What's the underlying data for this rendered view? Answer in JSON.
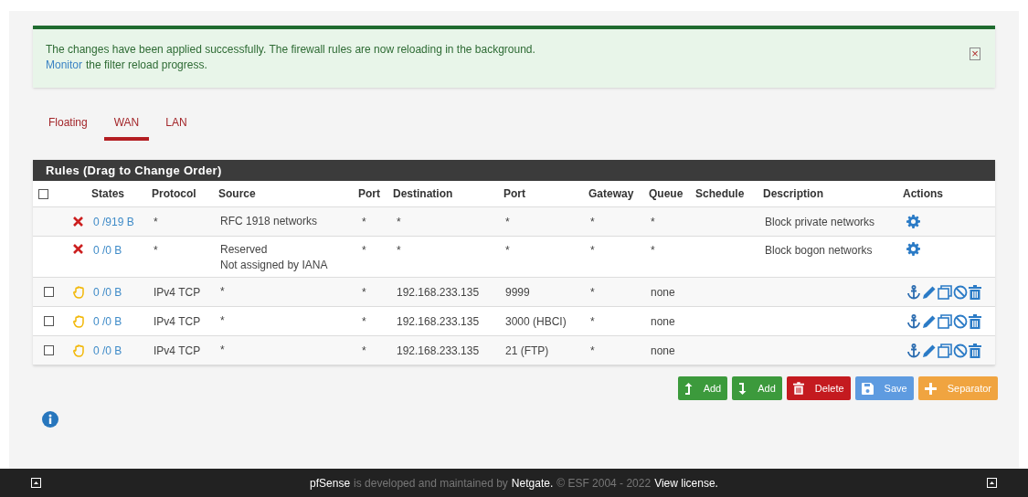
{
  "alert": {
    "message": "The changes have been applied successfully. The firewall rules are now reloading in the background.",
    "link": "Monitor",
    "link_rest": "the filter reload progress.",
    "close": "×"
  },
  "tabs": [
    {
      "label": "Floating",
      "selected": false
    },
    {
      "label": "WAN",
      "selected": true
    },
    {
      "label": "LAN",
      "selected": false
    }
  ],
  "panel": {
    "title": "Rules (Drag to Change Order)"
  },
  "table": {
    "select_all_checked": false,
    "columns": [
      "States",
      "Protocol",
      "Source",
      "Port",
      "Destination",
      "Port",
      "Gateway",
      "Queue",
      "Schedule",
      "Description",
      "Actions"
    ],
    "rows": [
      {
        "kind": "block",
        "states": "0 /919 B",
        "protocol": "*",
        "source": [
          "RFC 1918 networks"
        ],
        "source_port": "*",
        "destination": "*",
        "port": "*",
        "gateway": "*",
        "queue": "*",
        "description": "Block private networks"
      },
      {
        "kind": "block",
        "states": "0 /0 B",
        "protocol": "*",
        "source": [
          "Reserved",
          "Not assigned by IANA"
        ],
        "source_port": "*",
        "destination": "*",
        "port": "*",
        "gateway": "*",
        "queue": "*",
        "description": "Block bogon networks"
      },
      {
        "kind": "pass",
        "checked": false,
        "states": "0 /0 B",
        "protocol": "IPv4 TCP",
        "source": [
          "*"
        ],
        "source_port": "*",
        "destination": "192.168.233.135",
        "port": "9999",
        "gateway": "*",
        "queue": "none"
      },
      {
        "kind": "pass",
        "checked": false,
        "states": "0 /0 B",
        "protocol": "IPv4 TCP",
        "source": [
          "*"
        ],
        "source_port": "*",
        "destination": "192.168.233.135",
        "port": "3000 (HBCI)",
        "gateway": "*",
        "queue": "none"
      },
      {
        "kind": "pass",
        "checked": false,
        "states": "0 /0 B",
        "protocol": "IPv4 TCP",
        "source": [
          "*"
        ],
        "source_port": "*",
        "destination": "192.168.233.135",
        "port": "21 (FTP)",
        "gateway": "*",
        "queue": "none"
      }
    ]
  },
  "buttons": [
    {
      "kind": "add_top",
      "label": "Add"
    },
    {
      "kind": "add_bottom",
      "label": "Add"
    },
    {
      "kind": "delete",
      "label": "Delete"
    },
    {
      "kind": "save",
      "label": "Save"
    },
    {
      "kind": "separator",
      "label": "Separator"
    }
  ],
  "footer": {
    "brand": "pfSense",
    "text1": "is developed and maintained by",
    "company": "Netgate.",
    "text2": "© ESF 2004 - 2022",
    "license": "View license."
  }
}
